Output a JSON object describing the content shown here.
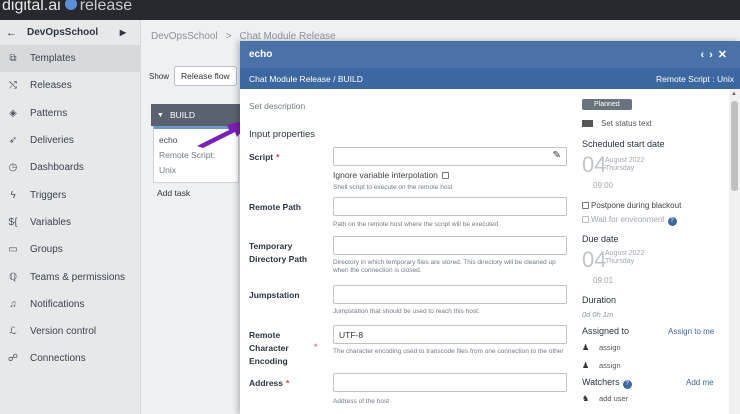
{
  "topbar": {
    "brand": "digital.ai",
    "product": "release"
  },
  "sidebar": {
    "title": "DevOpsSchool",
    "items": [
      {
        "label": "Templates",
        "icon": "templates-icon",
        "glyph": "⧉"
      },
      {
        "label": "Releases",
        "icon": "releases-icon",
        "glyph": "⤭"
      },
      {
        "label": "Patterns",
        "icon": "patterns-icon",
        "glyph": "◈"
      },
      {
        "label": "Deliveries",
        "icon": "deliveries-icon",
        "glyph": "➶"
      },
      {
        "label": "Dashboards",
        "icon": "dashboards-icon",
        "glyph": "◷"
      },
      {
        "label": "Triggers",
        "icon": "triggers-icon",
        "glyph": "ϟ"
      },
      {
        "label": "Variables",
        "icon": "variables-icon",
        "glyph": "${"
      },
      {
        "label": "Groups",
        "icon": "groups-icon",
        "glyph": "▭"
      },
      {
        "label": "Teams & permissions",
        "icon": "teams-icon",
        "glyph": "ℚ"
      },
      {
        "label": "Notifications",
        "icon": "bell-icon",
        "glyph": "♫"
      },
      {
        "label": "Version control",
        "icon": "version-control-icon",
        "glyph": "ℒ"
      },
      {
        "label": "Connections",
        "icon": "connections-icon",
        "glyph": "☍"
      }
    ]
  },
  "main": {
    "breadcrumb": [
      "DevOpsSchool",
      "Chat Module Release"
    ],
    "breadcrumb_sep": ">",
    "show_label": "Show",
    "show_value": "Release flow",
    "phase": {
      "name": "BUILD",
      "task_title": "echo",
      "task_sub": "Remote Script: Unix",
      "add_task": "Add task"
    }
  },
  "modal": {
    "title": "echo",
    "subtitle": "Chat Module Release / BUILD",
    "task_type": "Remote Script : Unix",
    "description_placeholder": "Set description",
    "section": "Input properties",
    "fields": {
      "script": {
        "label": "Script",
        "value": "",
        "interp": "Ignore variable interpolation",
        "help": "Shell script to execute on the remote host"
      },
      "remote_path": {
        "label": "Remote Path",
        "value": "",
        "help": "Path on the remote host where the script will be executed"
      },
      "temp_dir": {
        "label": "Temporary Directory Path",
        "value": "",
        "help": "Directory in which temporary files are stored. This directory will be cleaned up when the connection is closed."
      },
      "jumpstation": {
        "label": "Jumpstation",
        "value": "",
        "help": "Jumpstation that should be used to reach this host."
      },
      "encoding": {
        "label": "Remote Character Encoding",
        "value": "UTF-8",
        "help": "The character encoding used to transcode files from one connection to the other"
      },
      "address": {
        "label": "Address",
        "value": "",
        "help": "Address of the host"
      }
    },
    "right": {
      "status": "Planned",
      "status_text": "Set status text",
      "start_heading": "Scheduled start date",
      "start_day": "04",
      "start_month": "August 2022",
      "start_weekday": "Thursday",
      "start_time": "09:00",
      "postpone": "Postpone during blackout",
      "wait_env": "Wait for environment",
      "due_heading": "Due date",
      "due_day": "04",
      "due_month": "August 2022",
      "due_weekday": "Thursday",
      "due_time": "09:01",
      "duration_heading": "Duration",
      "duration": "0d 0h 1m",
      "assigned_heading": "Assigned to",
      "assign_to_me": "Assign to me",
      "assign1": "assign",
      "assign2": "assign",
      "watchers_heading": "Watchers",
      "add_me": "Add me",
      "add_user": "add user"
    }
  }
}
